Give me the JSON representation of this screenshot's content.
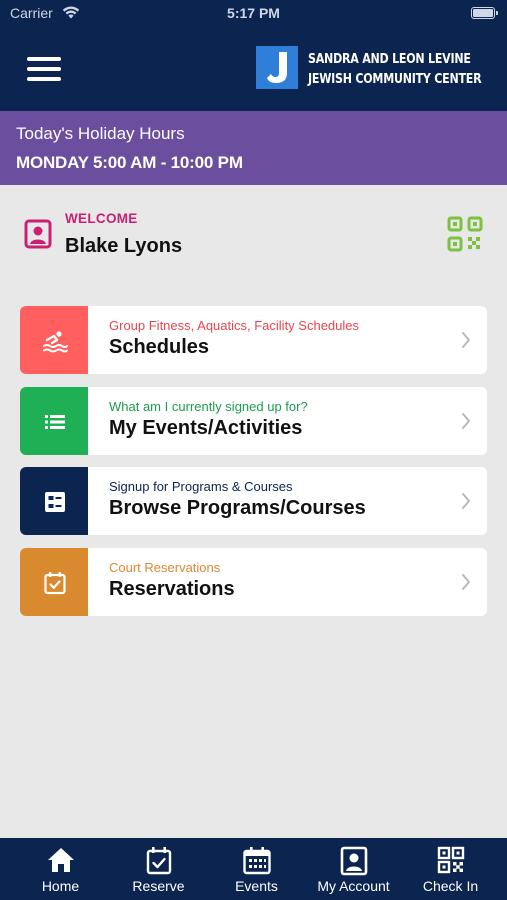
{
  "status_bar": {
    "carrier": "Carrier",
    "time": "5:17 PM"
  },
  "header": {
    "logo_line1": "SANDRA AND LEON LEVINE",
    "logo_line2": "JEWISH COMMUNITY CENTER",
    "logo_letter": "J"
  },
  "holiday": {
    "title": "Today's Holiday Hours",
    "hours": "MONDAY 5:00 AM - 10:00 PM"
  },
  "welcome": {
    "label": "WELCOME",
    "name": "Blake Lyons"
  },
  "cards": [
    {
      "subtitle": "Group Fitness, Aquatics, Facility Schedules",
      "title": "Schedules",
      "color": "#ff5f5f",
      "subtitle_color": "#e8454f",
      "icon": "swimming-icon"
    },
    {
      "subtitle": "What am I currently signed up for?",
      "title": "My Events/Activities",
      "color": "#1faf55",
      "subtitle_color": "#1c9c4c",
      "icon": "list-icon"
    },
    {
      "subtitle": "Signup for Programs & Courses",
      "title": "Browse Programs/Courses",
      "color": "#0c2450",
      "subtitle_color": "#0c2450",
      "icon": "form-icon"
    },
    {
      "subtitle": "Court Reservations",
      "title": "Reservations",
      "color": "#d98a2e",
      "subtitle_color": "#d98a2e",
      "icon": "calendar-check-icon"
    }
  ],
  "tabs": [
    {
      "label": "Home",
      "icon": "home-icon"
    },
    {
      "label": "Reserve",
      "icon": "calendar-check-icon"
    },
    {
      "label": "Events",
      "icon": "calendar-icon"
    },
    {
      "label": "My Account",
      "icon": "account-icon"
    },
    {
      "label": "Check In",
      "icon": "qr-code-icon"
    }
  ],
  "colors": {
    "navy": "#0c2450",
    "purple": "#6b4e9e",
    "magenta": "#cc1f74",
    "green": "#7cc242"
  }
}
